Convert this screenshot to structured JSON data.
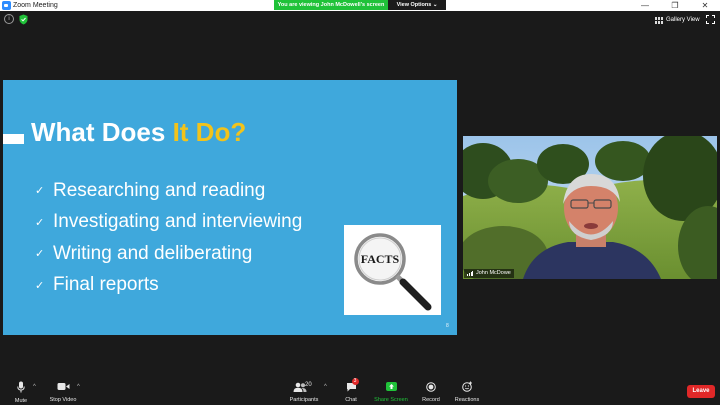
{
  "window": {
    "title": "Zoom Meeting",
    "minimize_glyph": "—",
    "restore_glyph": "❐",
    "close_glyph": "✕"
  },
  "share_banner": {
    "text": "You are viewing John McDowell's screen",
    "view_options_label": "View Options ⌄",
    "color": "#20c239"
  },
  "topbar": {
    "info_glyph": "i",
    "gallery_view_label": "Gallery View"
  },
  "slide": {
    "title_part1": "What Does ",
    "title_highlight": "It Do?",
    "bullets": [
      "Researching and reading",
      "Investigating and interviewing",
      "Writing and deliberating",
      "Final reports"
    ],
    "check_glyph": "✓",
    "image_word": "FACTS",
    "slide_number": "8",
    "background_color": "#3fa8dc",
    "highlight_color": "#f2c31b"
  },
  "video": {
    "participant_name": "John McDowe"
  },
  "toolbar": {
    "mute_label": "Mute",
    "stop_video_label": "Stop Video",
    "participants_label": "Participants",
    "participants_count": "20",
    "chat_label": "Chat",
    "chat_badge": "3",
    "share_screen_label": "Share Screen",
    "record_label": "Record",
    "reactions_label": "Reactions",
    "leave_label": "Leave",
    "caret_glyph": "^",
    "leave_color": "#e02828"
  }
}
